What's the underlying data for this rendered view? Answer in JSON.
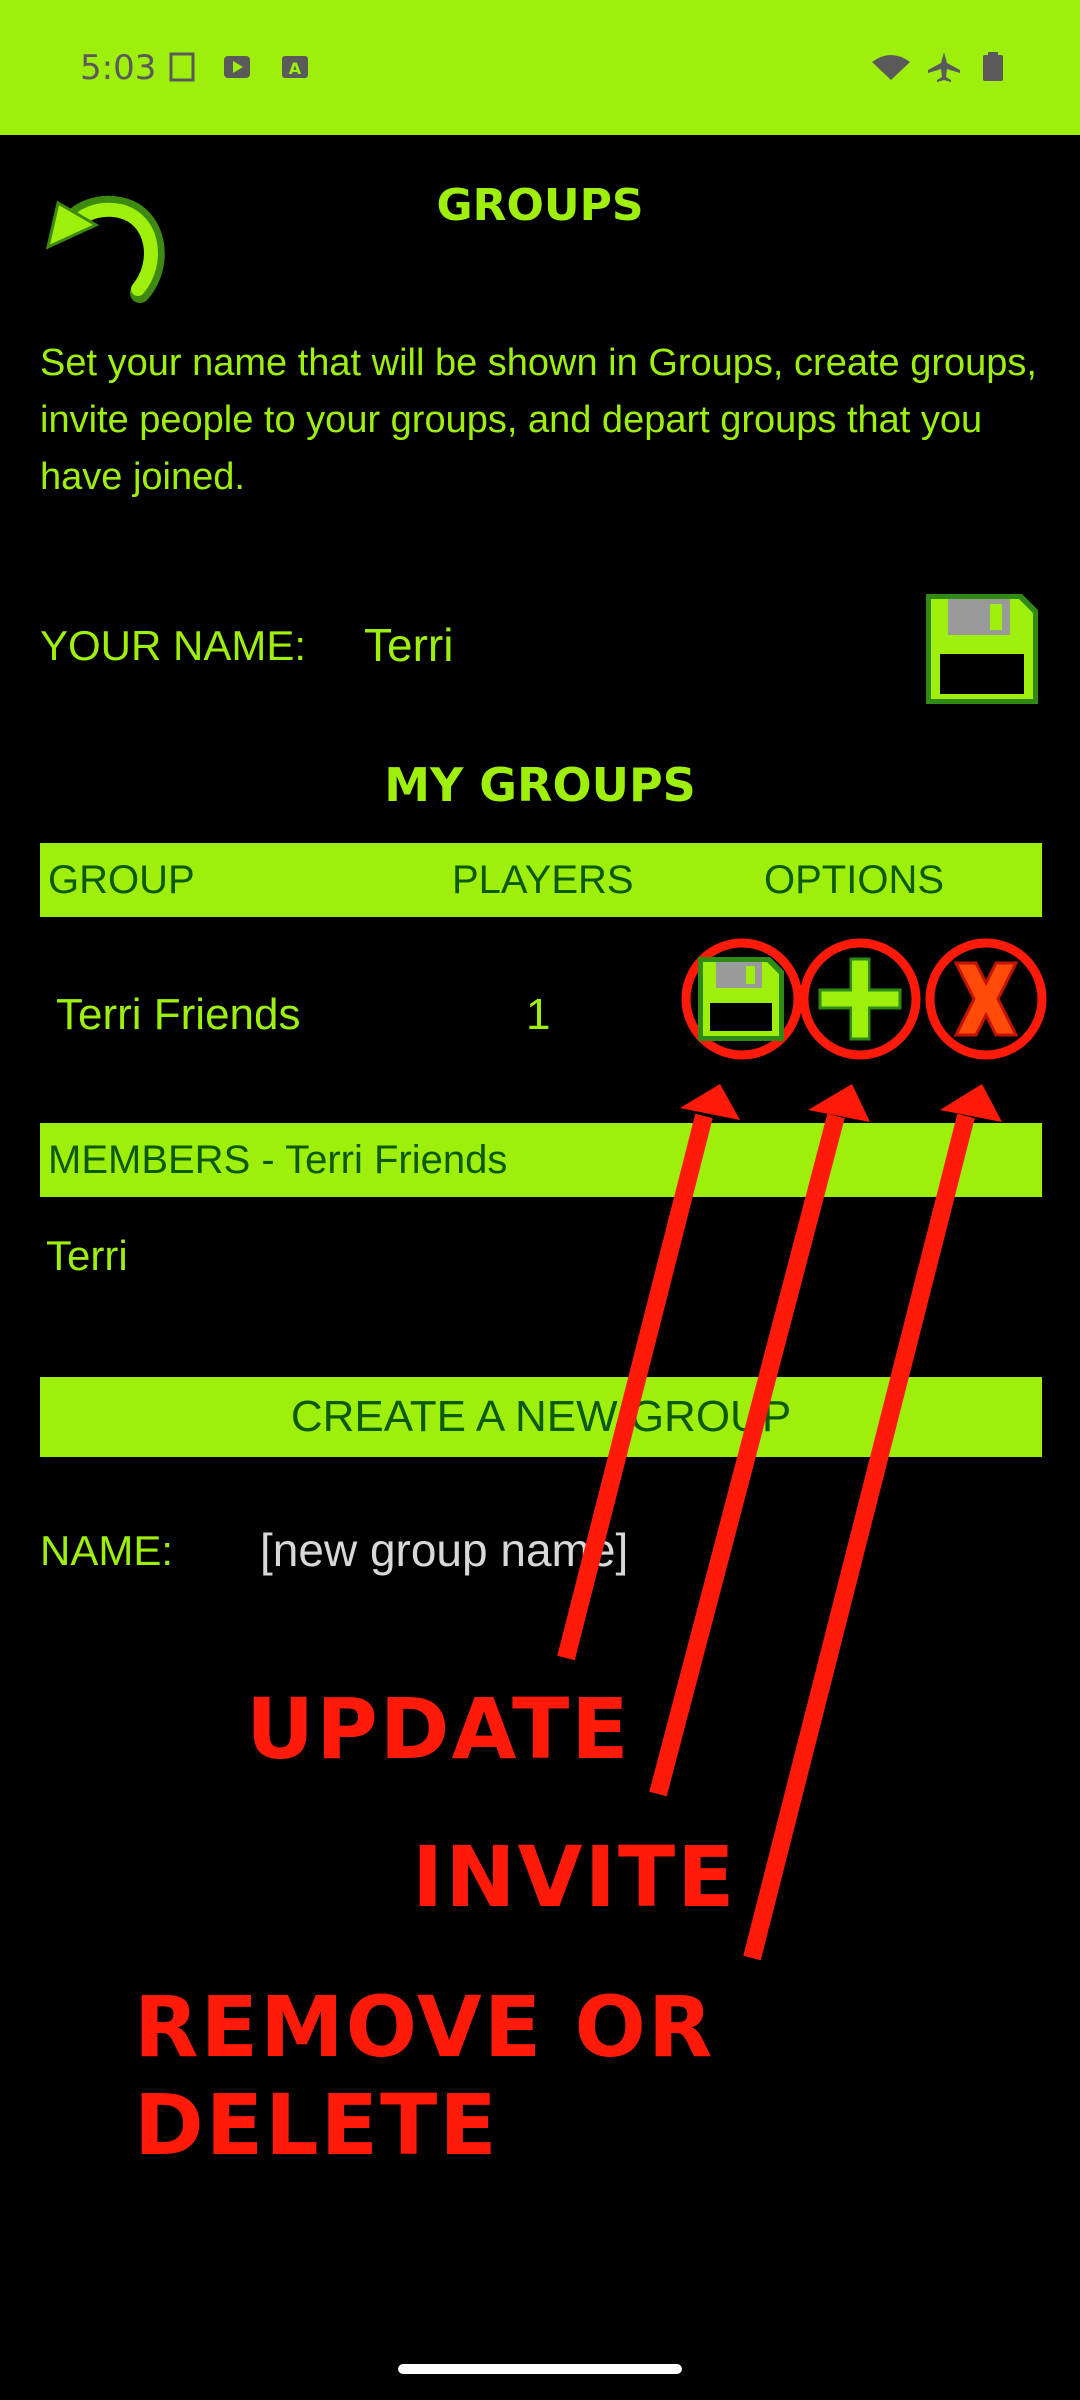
{
  "status_bar": {
    "time": "5:03",
    "bg_color": "#9ef00c",
    "icons_left": [
      "sim-card-icon",
      "play-store-icon",
      "a-notification-icon"
    ],
    "icons_right": [
      "wifi-icon",
      "airplane-icon",
      "battery-icon"
    ]
  },
  "header": {
    "title": "GROUPS",
    "back_icon": "undo-arrow-icon"
  },
  "description": "Set your name that will be shown in Groups, create groups, invite people to your groups, and depart groups that you have joined.",
  "your_name": {
    "label": "YOUR NAME:",
    "value": "Terri",
    "save_icon": "floppy-disk-icon"
  },
  "my_groups": {
    "title": "MY GROUPS",
    "columns": [
      "GROUP",
      "PLAYERS",
      "OPTIONS"
    ],
    "rows": [
      {
        "group": "Terri Friends",
        "players": "1"
      }
    ],
    "option_icons": [
      "floppy-disk-icon",
      "plus-icon",
      "x-icon"
    ]
  },
  "members": {
    "header": "MEMBERS - Terri Friends",
    "list": [
      "Terri"
    ]
  },
  "create_group": {
    "title": "CREATE A NEW GROUP",
    "name_label": "NAME:",
    "name_placeholder": "[new group name]"
  },
  "annotations": {
    "update": "UPDATE",
    "invite": "INVITE",
    "remove": "REMOVE OR DELETE",
    "color": "#ff1a0a"
  },
  "colors": {
    "accent": "#9ef00c",
    "dark_green_text": "#0d5a0d",
    "background": "#000000",
    "annotation_red": "#ff1a0a"
  }
}
